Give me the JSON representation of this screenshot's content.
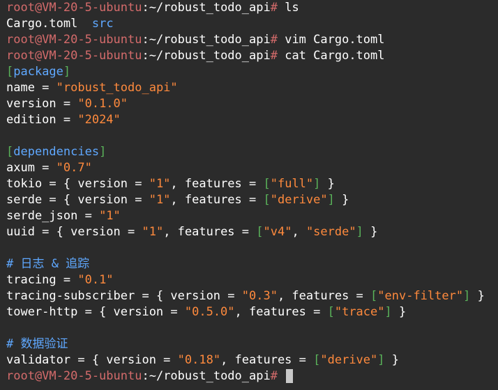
{
  "prompt": {
    "user_host": "root@VM-20-5-ubuntu",
    "colon": ":",
    "path": "~/robust_todo_api",
    "symbol": "#"
  },
  "commands": {
    "ls": " ls",
    "vim": " vim Cargo.toml",
    "cat": " cat Cargo.toml"
  },
  "ls_output": {
    "file": "Cargo.toml",
    "dir": "src"
  },
  "toml": {
    "package_header": "package",
    "name_key": "name = ",
    "name_val": "\"robust_todo_api\"",
    "version_key": "version = ",
    "version_val": "\"0.1.0\"",
    "edition_key": "edition = ",
    "edition_val": "\"2024\"",
    "deps_header": "dependencies",
    "axum_key": "axum = ",
    "axum_val": "\"0.7\"",
    "tokio_pre": "tokio = { version = ",
    "tokio_ver": "\"1\"",
    "tokio_mid": ", features = ",
    "tokio_feat": "\"full\"",
    "tokio_end": " }",
    "serde_pre": "serde = { version = ",
    "serde_ver": "\"1\"",
    "serde_mid": ", features = ",
    "serde_feat": "\"derive\"",
    "serde_end": " }",
    "serde_json_key": "serde_json = ",
    "serde_json_val": "\"1\"",
    "uuid_pre": "uuid = { version = ",
    "uuid_ver": "\"1\"",
    "uuid_mid": ", features = ",
    "uuid_feat1": "\"v4\"",
    "uuid_comma": ", ",
    "uuid_feat2": "\"serde\"",
    "uuid_end": " }",
    "comment_log": "# 日志 & 追踪",
    "tracing_key": "tracing = ",
    "tracing_val": "\"0.1\"",
    "ts_pre": "tracing-subscriber = { version = ",
    "ts_ver": "\"0.3\"",
    "ts_mid": ", features = ",
    "ts_feat": "\"env-filter\"",
    "ts_end": " }",
    "th_pre": "tower-http = { version = ",
    "th_ver": "\"0.5.0\"",
    "th_mid": ", features = ",
    "th_feat": "\"trace\"",
    "th_end": " }",
    "comment_valid": "# 数据验证",
    "val_pre": "validator = { version = ",
    "val_ver": "\"0.18\"",
    "val_mid": ", features = ",
    "val_feat": "\"derive\"",
    "val_end": " }"
  },
  "colors": {
    "background": "#2b2b2b",
    "prompt": "#d46b6b",
    "string": "#ff8a3d",
    "bracket": "#5ab35a",
    "section": "#5fa8ff",
    "comment": "#5fa8ff"
  }
}
